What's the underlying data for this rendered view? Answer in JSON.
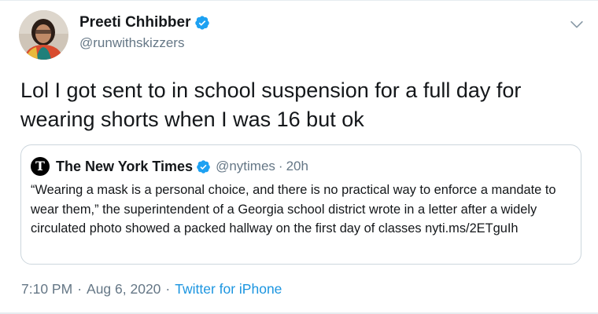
{
  "author": {
    "name": "Preeti Chhibber",
    "handle": "@runwithskizzers",
    "verified": true
  },
  "tweet": {
    "text": "Lol I got sent to in school suspension for a full day for wearing shorts when I was 16 but ok"
  },
  "quoted_tweet": {
    "logo_letter": "T",
    "name": "The New York Times",
    "verified": true,
    "handle": "@nytimes",
    "separator": "·",
    "time": "20h",
    "text": "“Wearing a mask is a personal choice, and there is no practical way to enforce a mandate to wear them,” the superintendent of a Georgia school district wrote in a letter after a widely circulated photo showed a packed hallway on the first day of classes nyti.ms/2ETguIh"
  },
  "meta": {
    "time": "7:10 PM",
    "separator1": "·",
    "date": "Aug 6, 2020",
    "separator2": "·",
    "source": "Twitter for iPhone"
  },
  "icons": {
    "verified": "verified-badge-icon",
    "menu": "chevron-down-icon"
  },
  "colors": {
    "accent": "#1da1f2",
    "link": "#1b95e0",
    "secondary_text": "#657786",
    "border": "#ccd6dd"
  }
}
